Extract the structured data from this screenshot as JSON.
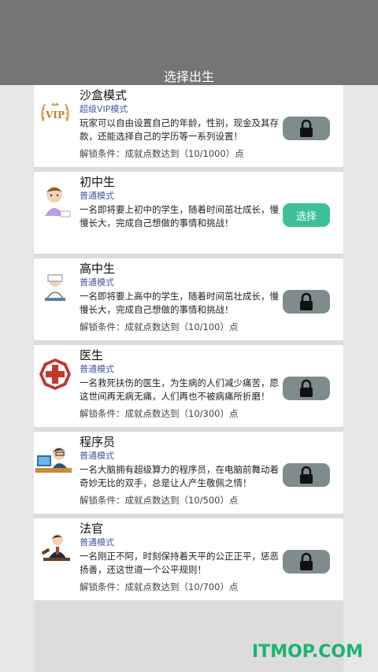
{
  "header": {
    "title": "选择出生"
  },
  "cards": [
    {
      "title": "沙盒模式",
      "mode": "超级VIP模式",
      "desc": "玩家可以自由设置自己的年龄，性别，现金及其存款，还能选择自己的学历等一系列设置！",
      "cond": "解锁条件：成就点数达到（10/1000）点",
      "locked": true,
      "icon": "vip-icon"
    },
    {
      "title": "初中生",
      "mode": "普通模式",
      "desc": "一名即将要上初中的学生，随着时间茁壮成长，慢慢长大，完成自己想做的事情和挑战！",
      "cond": "",
      "locked": false,
      "button": "选择",
      "icon": "student-icon"
    },
    {
      "title": "高中生",
      "mode": "普通模式",
      "desc": "一名即将要上高中的学生，随着时间茁壮成长，慢慢长大，完成自己想做的事情和挑战！",
      "cond": "解锁条件：成就点数达到（10/100）点",
      "locked": true,
      "icon": "reading-student-icon"
    },
    {
      "title": "医生",
      "mode": "普通模式",
      "desc": "一名救死扶伤的医生，为生病的人们减少痛苦，愿这世间再无病无痛，人们再也不被病痛所折磨！",
      "cond": "解锁条件：成就点数达到（10/300）点",
      "locked": true,
      "icon": "medical-cross-icon"
    },
    {
      "title": "程序员",
      "mode": "普通模式",
      "desc": "一名大脑拥有超级算力的程序员，在电脑前舞动着奇妙无比的双手，总是让人产生敬佩之情！",
      "cond": "解锁条件：成就点数达到（10/500）点",
      "locked": true,
      "icon": "programmer-icon"
    },
    {
      "title": "法官",
      "mode": "普通模式",
      "desc": "一名刚正不阿，时刻保持着天平的公正正平，惩恶扬善，还这世道一个公平规则！",
      "cond": "解锁条件：成就点数达到（10/700）点",
      "locked": true,
      "icon": "judge-icon"
    }
  ],
  "watermark": "ITMOP.COM"
}
